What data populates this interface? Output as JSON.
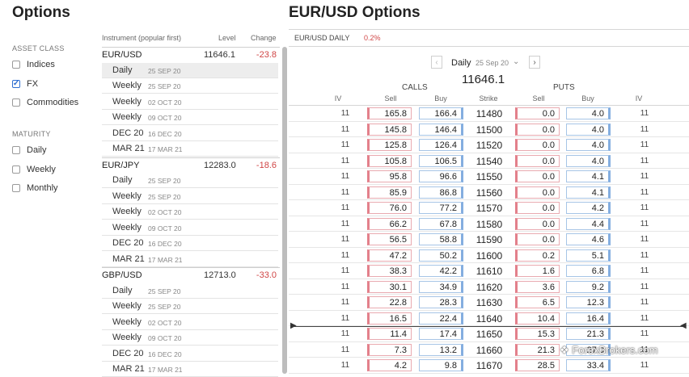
{
  "left_panel": {
    "title": "Options",
    "asset_class_label": "ASSET CLASS",
    "asset_classes": [
      {
        "label": "Indices",
        "checked": false
      },
      {
        "label": "FX",
        "checked": true
      },
      {
        "label": "Commodities",
        "checked": false
      }
    ],
    "maturity_label": "MATURITY",
    "maturities": [
      {
        "label": "Daily",
        "checked": false
      },
      {
        "label": "Weekly",
        "checked": false
      },
      {
        "label": "Monthly",
        "checked": false
      }
    ]
  },
  "middle_panel": {
    "headers": {
      "instrument": "Instrument (popular first)",
      "level": "Level",
      "change": "Change"
    },
    "instruments": [
      {
        "name": "EUR/USD",
        "level": "11646.1",
        "change": "-23.8",
        "expiries": [
          {
            "label": "Daily",
            "date": "25 SEP 20",
            "active": true
          },
          {
            "label": "Weekly",
            "date": "25 SEP 20"
          },
          {
            "label": "Weekly",
            "date": "02 OCT 20"
          },
          {
            "label": "Weekly",
            "date": "09 OCT 20"
          },
          {
            "label": "DEC 20",
            "date": "16 DEC 20"
          },
          {
            "label": "MAR 21",
            "date": "17 MAR 21"
          }
        ]
      },
      {
        "name": "EUR/JPY",
        "level": "12283.0",
        "change": "-18.6",
        "expiries": [
          {
            "label": "Daily",
            "date": "25 SEP 20"
          },
          {
            "label": "Weekly",
            "date": "25 SEP 20"
          },
          {
            "label": "Weekly",
            "date": "02 OCT 20"
          },
          {
            "label": "Weekly",
            "date": "09 OCT 20"
          },
          {
            "label": "DEC 20",
            "date": "16 DEC 20"
          },
          {
            "label": "MAR 21",
            "date": "17 MAR 21"
          }
        ]
      },
      {
        "name": "GBP/USD",
        "level": "12713.0",
        "change": "-33.0",
        "expiries": [
          {
            "label": "Daily",
            "date": "25 SEP 20"
          },
          {
            "label": "Weekly",
            "date": "25 SEP 20"
          },
          {
            "label": "Weekly",
            "date": "02 OCT 20"
          },
          {
            "label": "Weekly",
            "date": "09 OCT 20"
          },
          {
            "label": "DEC 20",
            "date": "16 DEC 20"
          },
          {
            "label": "MAR 21",
            "date": "17 MAR 21"
          }
        ]
      }
    ]
  },
  "right_panel": {
    "title": "EUR/USD Options",
    "market_label": "EUR/USD DAILY",
    "market_change": "0.2%",
    "expiry_selector": {
      "label": "Daily",
      "date": "25 Sep 20"
    },
    "underlying_level": "11646.1",
    "calls_label": "CALLS",
    "puts_label": "PUTS",
    "columns": {
      "iv": "IV",
      "sell": "Sell",
      "buy": "Buy",
      "strike": "Strike",
      "put_sell": "Sell",
      "put_buy": "Buy",
      "put_iv": "IV"
    },
    "rows": [
      {
        "civ": "11",
        "csell": "165.8",
        "cbuy": "166.4",
        "strike": "11480",
        "psell": "0.0",
        "pbuy": "4.0",
        "piv": "11"
      },
      {
        "civ": "11",
        "csell": "145.8",
        "cbuy": "146.4",
        "strike": "11500",
        "psell": "0.0",
        "pbuy": "4.0",
        "piv": "11"
      },
      {
        "civ": "11",
        "csell": "125.8",
        "cbuy": "126.4",
        "strike": "11520",
        "psell": "0.0",
        "pbuy": "4.0",
        "piv": "11"
      },
      {
        "civ": "11",
        "csell": "105.8",
        "cbuy": "106.5",
        "strike": "11540",
        "psell": "0.0",
        "pbuy": "4.0",
        "piv": "11"
      },
      {
        "civ": "11",
        "csell": "95.8",
        "cbuy": "96.6",
        "strike": "11550",
        "psell": "0.0",
        "pbuy": "4.1",
        "piv": "11"
      },
      {
        "civ": "11",
        "csell": "85.9",
        "cbuy": "86.8",
        "strike": "11560",
        "psell": "0.0",
        "pbuy": "4.1",
        "piv": "11"
      },
      {
        "civ": "11",
        "csell": "76.0",
        "cbuy": "77.2",
        "strike": "11570",
        "psell": "0.0",
        "pbuy": "4.2",
        "piv": "11"
      },
      {
        "civ": "11",
        "csell": "66.2",
        "cbuy": "67.8",
        "strike": "11580",
        "psell": "0.0",
        "pbuy": "4.4",
        "piv": "11"
      },
      {
        "civ": "11",
        "csell": "56.5",
        "cbuy": "58.8",
        "strike": "11590",
        "psell": "0.0",
        "pbuy": "4.6",
        "piv": "11"
      },
      {
        "civ": "11",
        "csell": "47.2",
        "cbuy": "50.2",
        "strike": "11600",
        "psell": "0.2",
        "pbuy": "5.1",
        "piv": "11"
      },
      {
        "civ": "11",
        "csell": "38.3",
        "cbuy": "42.2",
        "strike": "11610",
        "psell": "1.6",
        "pbuy": "6.8",
        "piv": "11"
      },
      {
        "civ": "11",
        "csell": "30.1",
        "cbuy": "34.9",
        "strike": "11620",
        "psell": "3.6",
        "pbuy": "9.2",
        "piv": "11"
      },
      {
        "civ": "11",
        "csell": "22.8",
        "cbuy": "28.3",
        "strike": "11630",
        "psell": "6.5",
        "pbuy": "12.3",
        "piv": "11"
      },
      {
        "civ": "11",
        "csell": "16.5",
        "cbuy": "22.4",
        "strike": "11640",
        "psell": "10.4",
        "pbuy": "16.4",
        "piv": "11"
      },
      {
        "civ": "11",
        "csell": "11.4",
        "cbuy": "17.4",
        "strike": "11650",
        "psell": "15.3",
        "pbuy": "21.3",
        "piv": "11"
      },
      {
        "civ": "11",
        "csell": "7.3",
        "cbuy": "13.2",
        "strike": "11660",
        "psell": "21.3",
        "pbuy": "27.0",
        "piv": "11"
      },
      {
        "civ": "11",
        "csell": "4.2",
        "cbuy": "9.8",
        "strike": "11670",
        "psell": "28.5",
        "pbuy": "33.4",
        "piv": "11"
      }
    ]
  },
  "watermark": "ForexBrokers.com",
  "colors": {
    "negative": "#d04545",
    "sell_border": "#e3808b",
    "buy_border": "#84aee0",
    "accent": "#2f6fd1"
  }
}
